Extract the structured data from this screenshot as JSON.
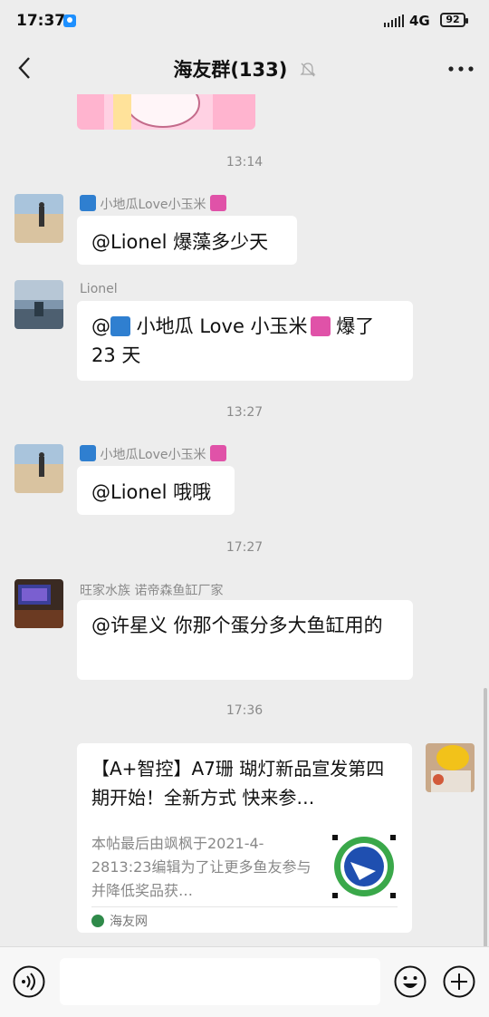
{
  "status": {
    "time": "17:37",
    "network": "4G",
    "battery": "92"
  },
  "header": {
    "title": "海友群(133)"
  },
  "timestamps": [
    "13:14",
    "13:27",
    "17:27",
    "17:36"
  ],
  "messages": [
    {
      "sender": "小地瓜Love小玉米",
      "text": "@Lionel  爆藻多少天"
    },
    {
      "sender": "Lionel",
      "text_prefix": "@",
      "text_name": " 小地瓜 Love 小玉米",
      "text_line1_tail": "  爆了",
      "text_line2": "23 天"
    },
    {
      "sender": "小地瓜Love小玉米",
      "text": "@Lionel  哦哦"
    },
    {
      "sender": "旺家水族  诺帝森鱼缸厂家",
      "text": "@许星义  你那个蛋分多大鱼缸用的"
    }
  ],
  "link_card": {
    "title": "【A+智控】A7珊 瑚灯新品宣发第四期开始！全新方式  快来参…",
    "description": "本帖最后由飒枫于2021-4-2813:23编辑为了让更多鱼友参与并降低奖品获…",
    "source": "海友网"
  },
  "colors": {
    "background": "#ededed",
    "bubble": "#ffffff",
    "meta_text": "#8a8a8a"
  }
}
